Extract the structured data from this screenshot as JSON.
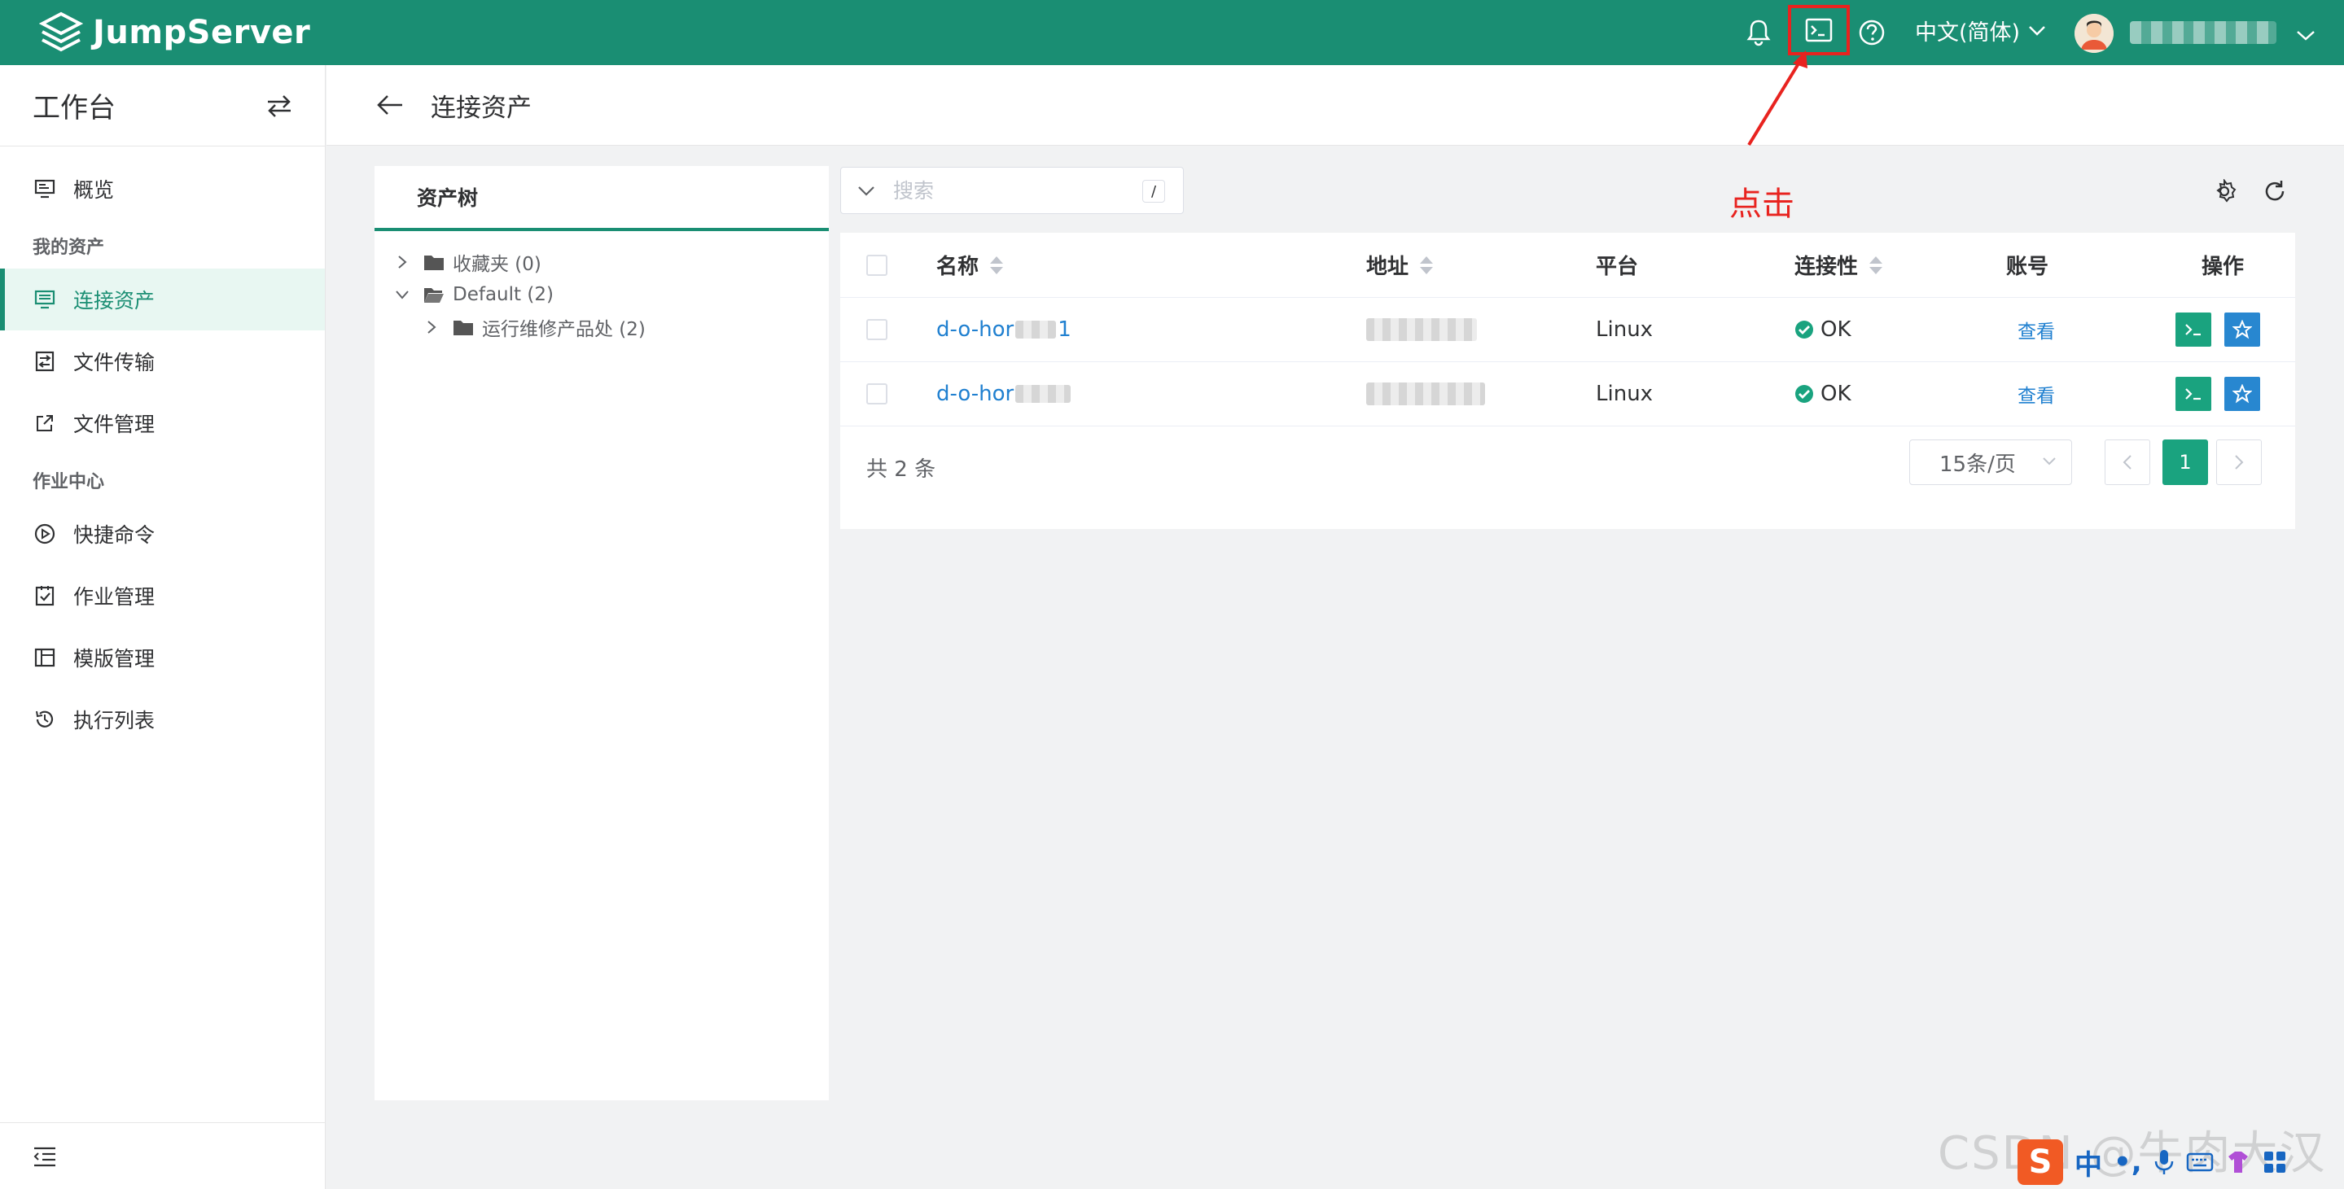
{
  "header": {
    "brand": "JumpServer",
    "language": "中文(简体)"
  },
  "sidebar": {
    "title": "工作台",
    "overview": "概览",
    "group_assets": "我的资产",
    "connect_assets": "连接资产",
    "file_transfer": "文件传输",
    "file_manage": "文件管理",
    "group_jobs": "作业中心",
    "quick_cmd": "快捷命令",
    "job_manage": "作业管理",
    "template_manage": "模版管理",
    "exec_list": "执行列表"
  },
  "page": {
    "title": "连接资产"
  },
  "tree": {
    "tab": "资产树",
    "favorites": "收藏夹 (0)",
    "default": "Default (2)",
    "child": "运行维修产品处 (2)"
  },
  "search": {
    "placeholder": "搜索",
    "shortcut": "/"
  },
  "annotation": "点击",
  "table": {
    "columns": {
      "name": "名称",
      "address": "地址",
      "platform": "平台",
      "connectivity": "连接性",
      "account": "账号",
      "actions": "操作"
    },
    "rows": [
      {
        "name": "d-o-hor",
        "name_tail": "1",
        "platform": "Linux",
        "status": "OK",
        "account": "查看"
      },
      {
        "name": "d-o-hor",
        "name_tail": "",
        "platform": "Linux",
        "status": "OK",
        "account": "查看"
      }
    ],
    "total": "共 2 条",
    "page_size": "15条/页",
    "current_page": "1"
  },
  "watermark": "CSDN @牛肉大汉堡",
  "ime": {
    "logo": "S",
    "mode": "中",
    "punct": "•,"
  },
  "colors": {
    "brand": "#1a8e73",
    "highlight": "#e8231f",
    "link": "#2080d0"
  }
}
